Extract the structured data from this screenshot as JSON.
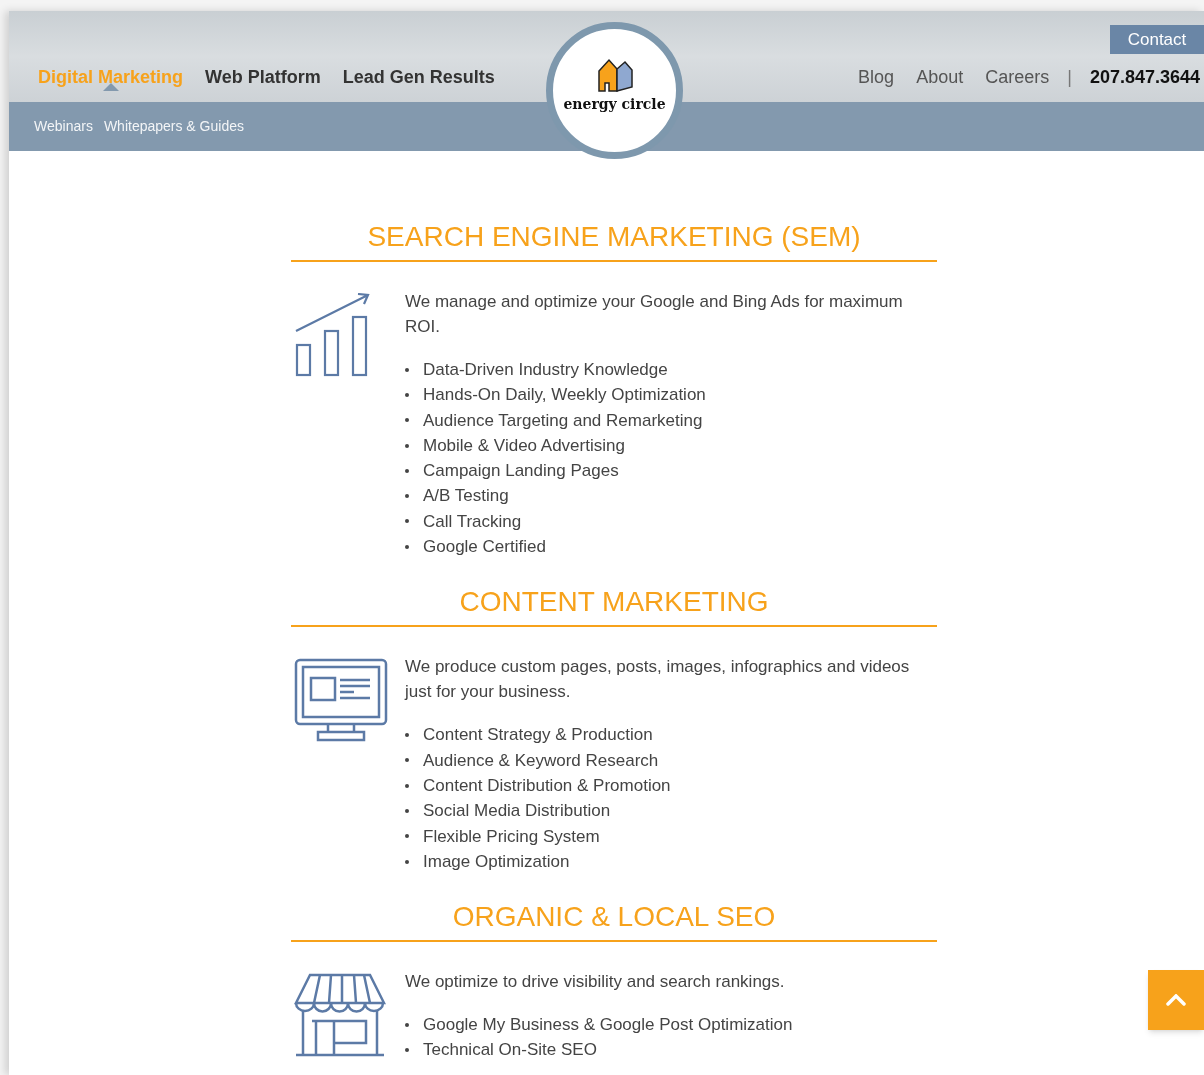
{
  "header": {
    "main_nav": [
      {
        "label": "Digital Marketing",
        "selected": true
      },
      {
        "label": "Web Platform",
        "selected": false
      },
      {
        "label": "Lead Gen Results",
        "selected": false
      }
    ],
    "sub_nav": [
      "Webinars",
      "Whitepapers & Guides"
    ],
    "logo": {
      "text": "energy circle"
    },
    "contact_button": "Contact",
    "secondary_nav": [
      "Blog",
      "About",
      "Careers"
    ],
    "separator": "|",
    "phone": "207.847.3644"
  },
  "sections": [
    {
      "title": "SEARCH ENGINE MARKETING (SEM)",
      "description": "We manage and optimize your Google and Bing Ads for maximum ROI.",
      "items": [
        "Data-Driven Industry Knowledge",
        "Hands-On Daily, Weekly Optimization",
        "Audience Targeting and Remarketing",
        "Mobile & Video Advertising",
        "Campaign Landing Pages",
        "A/B Testing",
        "Call Tracking",
        "Google Certified"
      ]
    },
    {
      "title": "CONTENT MARKETING",
      "description": "We produce custom pages, posts, images, infographics and videos just for your business.",
      "items": [
        "Content Strategy & Production",
        "Audience & Keyword Research",
        "Content Distribution & Promotion",
        "Social Media Distribution",
        "Flexible Pricing System",
        "Image Optimization"
      ]
    },
    {
      "title": "ORGANIC & LOCAL SEO",
      "description": "We optimize to drive visibility and search rankings.",
      "items": [
        "Google My Business & Google Post Optimization",
        "Technical On-Site SEO"
      ]
    }
  ]
}
